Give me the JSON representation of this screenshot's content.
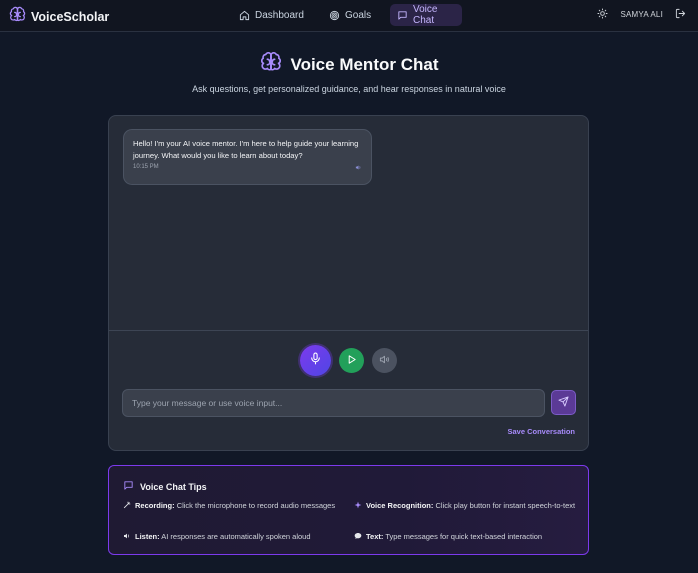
{
  "app": {
    "name": "VoiceScholar"
  },
  "nav": {
    "items": [
      {
        "label": "Dashboard",
        "icon": "home-icon",
        "active": false
      },
      {
        "label": "Goals",
        "icon": "target-icon",
        "active": false
      },
      {
        "label": "Voice Chat",
        "icon": "chat-icon",
        "active": true
      }
    ]
  },
  "user": {
    "name": "SAMYA ALI"
  },
  "header": {
    "title": "Voice Mentor Chat",
    "subtitle": "Ask questions, get personalized guidance, and hear responses in natural voice"
  },
  "chat": {
    "messages": [
      {
        "sender": "mentor",
        "text": "Hello! I'm your AI voice mentor. I'm here to help guide your learning journey. What would you like to learn about today?",
        "time": "10:15 PM"
      }
    ],
    "input_placeholder": "Type your message or use voice input...",
    "input_value": "",
    "save_label": "Save Conversation"
  },
  "tips": {
    "title": "Voice Chat Tips",
    "items": [
      {
        "label": "Recording:",
        "text": "Click the microphone to record audio messages",
        "icon": "wand-icon"
      },
      {
        "label": "Voice Recognition:",
        "text": "Click play button for instant speech-to-text",
        "icon": "sparkle-icon"
      },
      {
        "label": "Listen:",
        "text": "AI responses are automatically spoken aloud",
        "icon": "speaker-icon"
      },
      {
        "label": "Text:",
        "text": "Type messages for quick text-based interaction",
        "icon": "speech-bubble-icon"
      }
    ]
  },
  "colors": {
    "background": "#111827",
    "accent": "#7c3aed",
    "accent_light": "#a78bfa",
    "play_green": "#22a05a",
    "panel": "#262c38"
  }
}
